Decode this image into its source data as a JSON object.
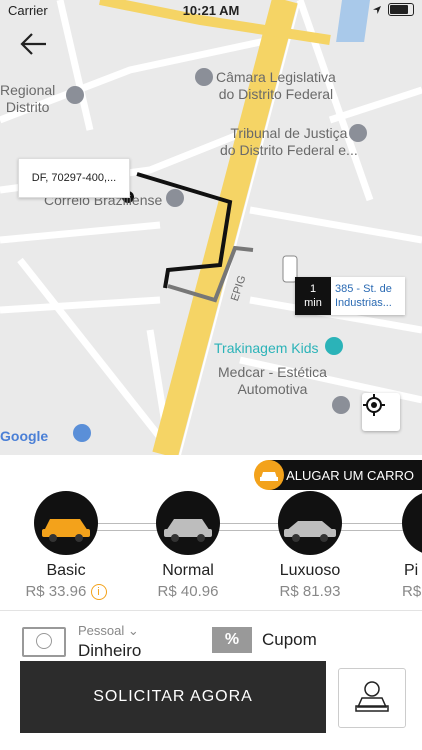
{
  "status_bar": {
    "carrier": "Carrier",
    "time": "10:21 AM"
  },
  "map": {
    "pois": {
      "regional": "Regional\nDistrito",
      "camara": "Câmara Legislativa\ndo Distrito Federal",
      "tribunal": "Tribunal de Justiça\ndo Distrito Federal e...",
      "correio": "Correio Braziliense",
      "trakinagem": "Trakinagem Kids",
      "medcar": "Medcar - Estética\nAutomotiva",
      "road": "EPIG"
    },
    "pickup_address": "DF, 70297-400,...",
    "eta_value": "1",
    "eta_unit": "min",
    "destination": "385 - St. de Industrias...",
    "google": "Google"
  },
  "panel": {
    "rent_car_label": "ALUGAR UM CARRO",
    "cars": [
      {
        "name": "Basic",
        "price": "R$ 33.96"
      },
      {
        "name": "Normal",
        "price": "R$ 40.96"
      },
      {
        "name": "Luxuoso",
        "price": "R$ 81.93"
      },
      {
        "name": "Pi",
        "price": "R$"
      }
    ],
    "payment_label": "Pessoal",
    "payment_value": "Dinheiro",
    "coupon_label": "Cupom",
    "request_button": "SOLICITAR AGORA"
  }
}
